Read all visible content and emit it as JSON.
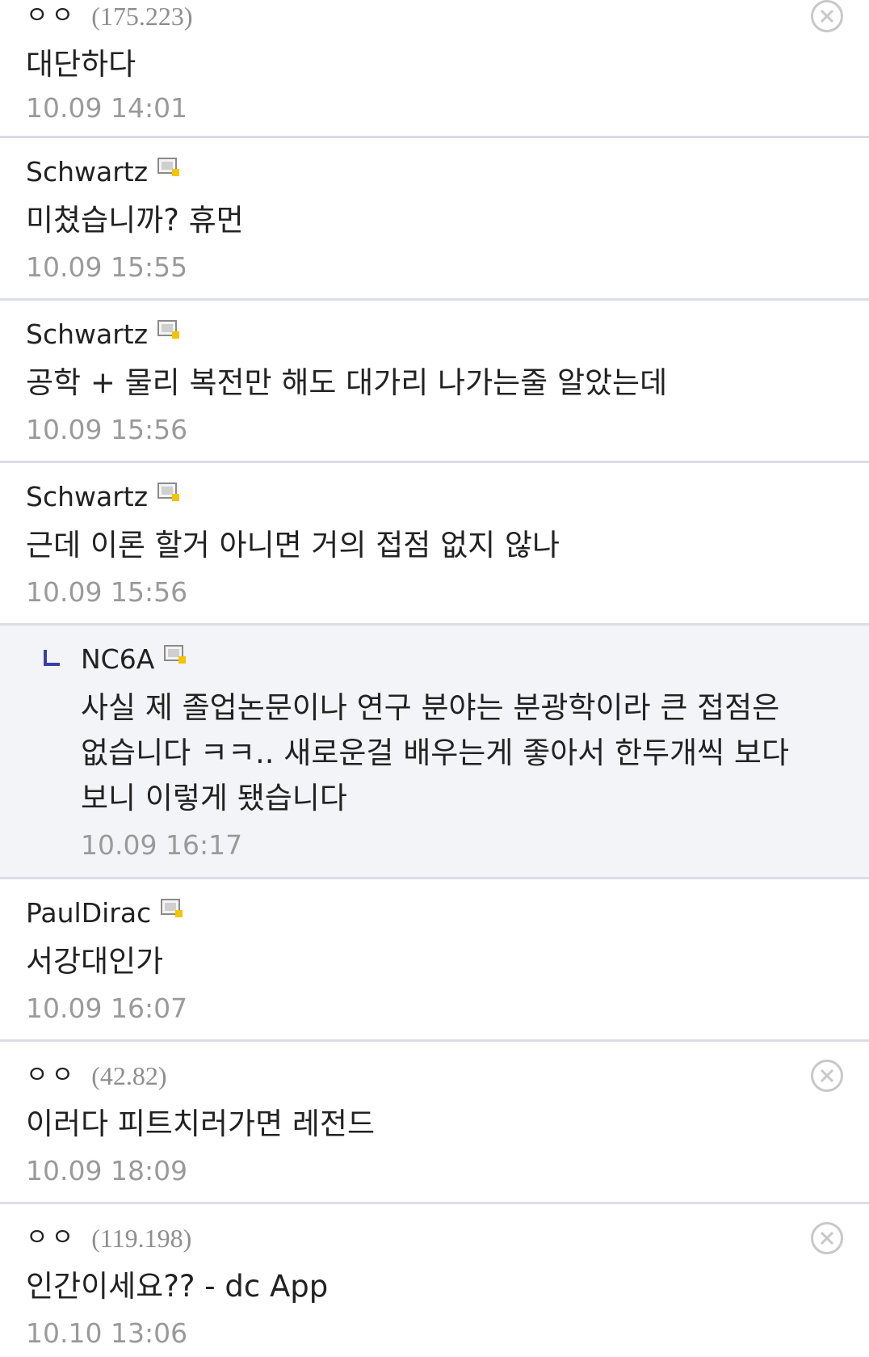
{
  "comments": [
    {
      "nickname": "ㅇㅇ",
      "ip": "(175.223)",
      "content": "대단하다",
      "date": "10.09 14:01",
      "has_delete": true
    },
    {
      "nickname": "Schwartz",
      "content": "미쳤습니까? 휴먼",
      "date": "10.09 15:55"
    },
    {
      "nickname": "Schwartz",
      "content": "공학 + 물리 복전만 해도 대가리 나가는줄 알았는데",
      "date": "10.09 15:56"
    },
    {
      "nickname": "Schwartz",
      "content": "근데 이론 할거 아니면 거의 접점 없지 않나",
      "date": "10.09 15:56"
    },
    {
      "nickname": "NC6A",
      "content": "사실 제 졸업논문이나 연구 분야는 분광학이라 큰 접점은 없습니다 ㅋㅋ.. 새로운걸 배우는게 좋아서 한두개씩 보다 보니 이렇게 됐습니다",
      "date": "10.09 16:17",
      "is_reply": true
    },
    {
      "nickname": "PaulDirac",
      "content": "서강대인가",
      "date": "10.09 16:07"
    },
    {
      "nickname": "ㅇㅇ",
      "ip": "(42.82)",
      "content": "이러다 피트치러가면 레전드",
      "date": "10.09 18:09",
      "has_delete": true
    },
    {
      "nickname": "ㅇㅇ",
      "ip": "(119.198)",
      "content": "인간이세요?? - dc App",
      "date": "10.10 13:06",
      "has_delete": true
    }
  ],
  "icons": {
    "gallog": "gallog-icon",
    "delete": "delete-icon",
    "reply": "reply-arrow-icon"
  },
  "colors": {
    "text": "#222222",
    "meta": "#9a9a9a",
    "divider": "#dcdce8",
    "reply_bg": "#f3f4f8",
    "reply_arrow": "#3b3fa8"
  }
}
